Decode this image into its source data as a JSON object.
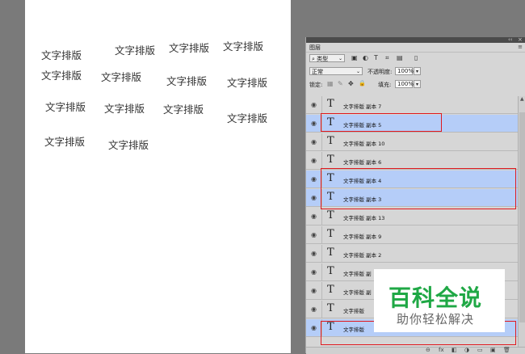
{
  "canvas": {
    "words": [
      "文字排版",
      "文字排版",
      "文字排版",
      "文字排版",
      "文字排版",
      "文字排版",
      "文字排版",
      "文字排版",
      "文字排版",
      "文字排版",
      "文字排版",
      "文字排版",
      "文字排版",
      "文字排版"
    ]
  },
  "panel": {
    "tab_label": "图层",
    "menu_glyph": "≡",
    "collapse_glyph": "‹‹",
    "close_glyph": "×",
    "filter_label": "类型",
    "filter_icons": [
      "▣",
      "◐",
      "T",
      "⌗",
      "▤"
    ],
    "blend_mode": "正常",
    "opacity_label": "不透明度:",
    "opacity_value": "100%",
    "lock_label": "锁定:",
    "lock_icons": [
      "▦",
      "✎",
      "✥",
      "🔒"
    ],
    "fill_label": "填充:",
    "fill_value": "100%",
    "layers": [
      {
        "name": "文字排版 副本 7",
        "selected": false
      },
      {
        "name": "文字排版 副本 5",
        "selected": true
      },
      {
        "name": "文字排版 副本 10",
        "selected": false
      },
      {
        "name": "文字排版 副本 6",
        "selected": false
      },
      {
        "name": "文字排版 副本 4",
        "selected": true
      },
      {
        "name": "文字排版 副本 3",
        "selected": true
      },
      {
        "name": "文字排版 副本 13",
        "selected": false
      },
      {
        "name": "文字排版 副本 9",
        "selected": false
      },
      {
        "name": "文字排版 副本 2",
        "selected": false
      },
      {
        "name": "文字排版 副",
        "selected": false
      },
      {
        "name": "文字排版 副",
        "selected": false
      },
      {
        "name": "文字排版",
        "selected": false
      },
      {
        "name": "文字排版",
        "selected": true
      }
    ],
    "layer_icon": "T",
    "eye_glyph": "◉",
    "bottom_icons": [
      "⊖",
      "fx",
      "◧",
      "◑",
      "▭",
      "▣",
      "🗑"
    ]
  },
  "watermark": {
    "main": "百科全说",
    "sub": "助你轻松解决",
    "color": "#1fa845"
  },
  "colors": {
    "selection": "#b5cdf8",
    "highlight_box": "#e0191e"
  }
}
